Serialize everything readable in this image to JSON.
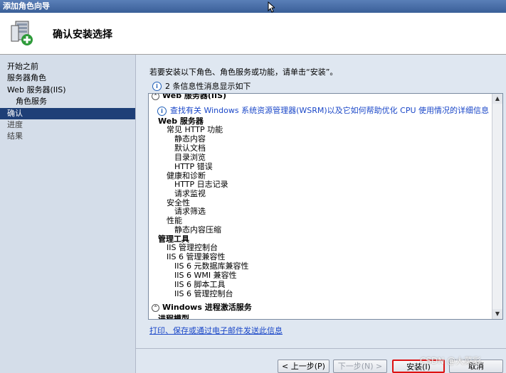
{
  "window": {
    "title": "添加角色向导"
  },
  "header": {
    "title": "确认安装选择"
  },
  "sidebar": {
    "items": [
      {
        "label": "开始之前"
      },
      {
        "label": "服务器角色"
      },
      {
        "label": "Web 服务器(IIS)"
      },
      {
        "label": "角色服务"
      },
      {
        "label": "确认"
      },
      {
        "label": "进度"
      },
      {
        "label": "结果"
      }
    ]
  },
  "main": {
    "instruction": "若要安装以下角色、角色服务或功能，请单击“安装”。",
    "info_note": "2 条信息性消息显示如下",
    "panel": {
      "section1_title": "Web 服务器(IIS)",
      "wsrm_link": "查找有关 Windows 系统资源管理器(WSRM)以及它如何帮助优化 CPU 使用情况的详细信息",
      "lines": [
        "Web 服务器",
        "常见 HTTP 功能",
        "静态内容",
        "默认文档",
        "目录浏览",
        "HTTP 错误",
        "健康和诊断",
        "HTTP 日志记录",
        "请求监视",
        "安全性",
        "请求筛选",
        "性能",
        "静态内容压缩",
        "管理工具",
        "IIS 管理控制台",
        "IIS 6 管理兼容性",
        "IIS 6 元数据库兼容性",
        "IIS 6 WMI 兼容性",
        "IIS 6 脚本工具",
        "IIS 6 管理控制台"
      ],
      "section2_title": "Windows 进程激活服务",
      "section2_partial": "进程模型"
    },
    "print_link": "打印、保存或通过电子邮件发送此信息"
  },
  "buttons": {
    "previous": "< 上一步(P)",
    "next": "下一步(N) >",
    "install": "安装(I)",
    "cancel": "取消"
  },
  "watermark": "CSDN @大菜彩"
}
